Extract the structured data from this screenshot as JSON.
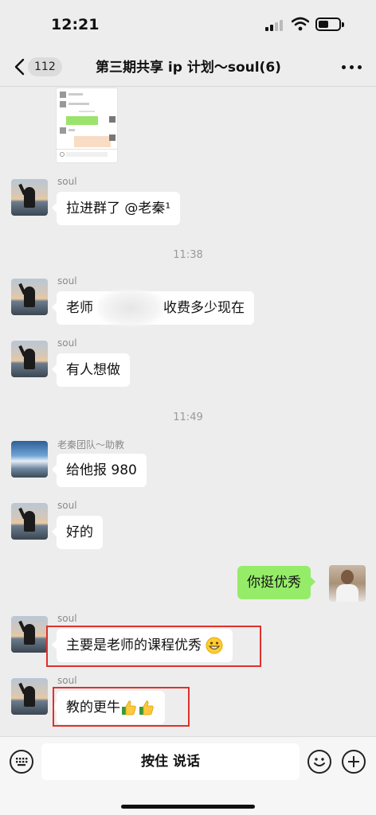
{
  "status_bar": {
    "time": "12:21"
  },
  "nav": {
    "unread_count": "112",
    "title": "第三期共享 ip 计划～soul(6)"
  },
  "messages": [
    {
      "sender": "soul",
      "text": "拉进群了 @老秦¹"
    },
    {
      "timestamp": "11:38"
    },
    {
      "sender": "soul",
      "text_before": "老师",
      "text_after": "收费多少现在"
    },
    {
      "sender": "soul",
      "text": "有人想做"
    },
    {
      "timestamp": "11:49"
    },
    {
      "sender": "老秦团队～助教",
      "text": "给他报 980"
    },
    {
      "sender": "soul",
      "text": "好的"
    },
    {
      "sender": "me",
      "text": "你挺优秀"
    },
    {
      "sender": "soul",
      "text": "主要是老师的课程优秀",
      "emoji": "grinning-face-icon"
    },
    {
      "sender": "soul",
      "text": "教的更牛",
      "emoji": "thumbs-up-icon"
    }
  ],
  "input_bar": {
    "hold_to_talk_label": "按住 说话"
  },
  "colors": {
    "background": "#ededed",
    "bubble_other": "#ffffff",
    "bubble_self": "#95ec69",
    "highlight_box": "#e0302b"
  }
}
